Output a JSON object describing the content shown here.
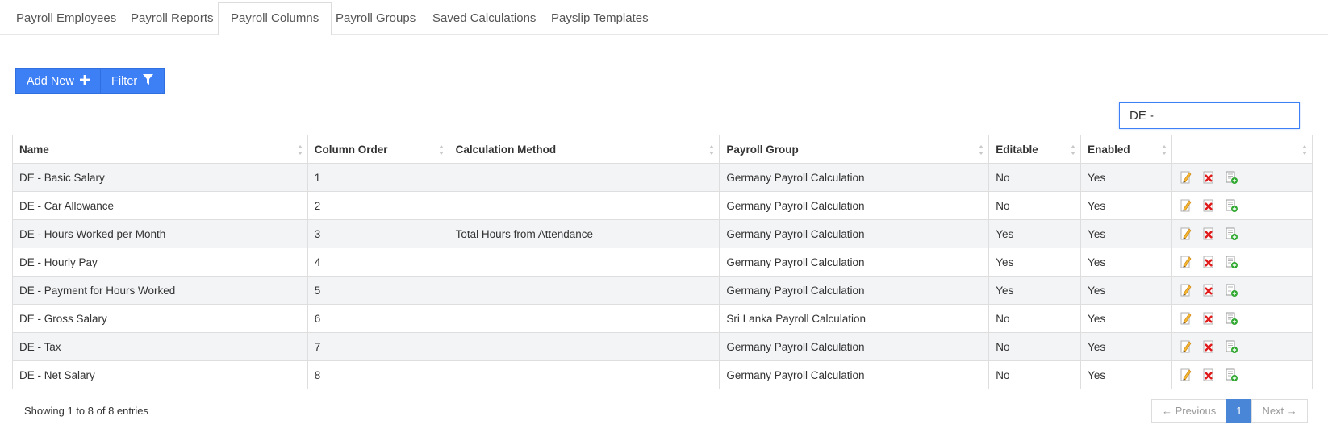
{
  "tabs": [
    {
      "label": "Payroll Employees"
    },
    {
      "label": "Payroll Reports"
    },
    {
      "label": "Payroll Columns"
    },
    {
      "label": "Payroll Groups"
    },
    {
      "label": "Saved Calculations"
    },
    {
      "label": "Payslip Templates"
    }
  ],
  "active_tab": "Payroll Columns",
  "toolbar": {
    "add_label": "Add New",
    "filter_label": "Filter",
    "add_icon": "plus-icon",
    "filter_icon": "funnel-icon"
  },
  "search": {
    "value": "DE - "
  },
  "table": {
    "headers": [
      "Name",
      "Column Order",
      "Calculation Method",
      "Payroll Group",
      "Editable",
      "Enabled",
      ""
    ],
    "rows": [
      [
        "DE - Basic Salary",
        "1",
        "",
        "Germany Payroll Calculation",
        "No",
        "Yes"
      ],
      [
        "DE - Car Allowance",
        "2",
        "",
        "Germany Payroll Calculation",
        "No",
        "Yes"
      ],
      [
        "DE - Hours Worked per Month",
        "3",
        "Total Hours from Attendance",
        "Germany Payroll Calculation",
        "Yes",
        "Yes"
      ],
      [
        "DE - Hourly Pay",
        "4",
        "",
        "Germany Payroll Calculation",
        "Yes",
        "Yes"
      ],
      [
        "DE - Payment for Hours Worked",
        "5",
        "",
        "Germany Payroll Calculation",
        "Yes",
        "Yes"
      ],
      [
        "DE - Gross Salary",
        "6",
        "",
        "Sri Lanka Payroll Calculation",
        "No",
        "Yes"
      ],
      [
        "DE - Tax",
        "7",
        "",
        "Germany Payroll Calculation",
        "No",
        "Yes"
      ],
      [
        "DE - Net Salary",
        "8",
        "",
        "Germany Payroll Calculation",
        "No",
        "Yes"
      ]
    ],
    "row_actions": [
      "edit-icon",
      "delete-icon",
      "copy-icon"
    ]
  },
  "footer": {
    "info": "Showing 1 to 8 of 8 entries",
    "prev_label": "← Previous",
    "page": "1",
    "next_label": "Next →"
  },
  "colors": {
    "primary": "#3d7ff5",
    "page_active": "#4a86d8",
    "row_stripe": "#f3f4f6"
  }
}
